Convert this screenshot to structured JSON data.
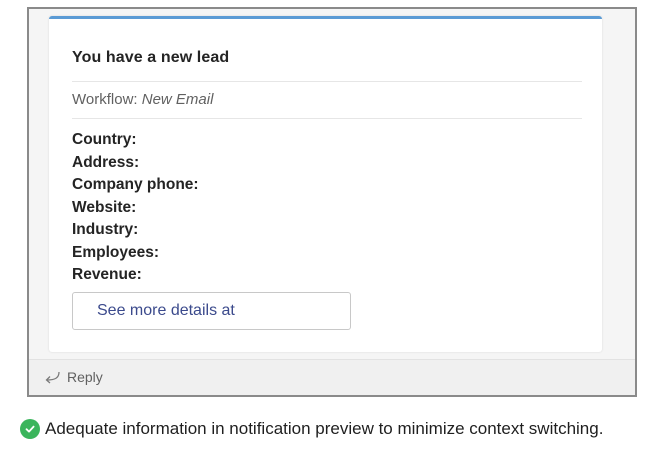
{
  "card": {
    "title": "You have a new lead",
    "workflow_label": "Workflow:",
    "workflow_value": "New Email",
    "fields": [
      "Country:",
      "Address:",
      "Company phone:",
      "Website:",
      "Industry:",
      "Employees:",
      "Revenue:"
    ],
    "details_button_label": "See more details at"
  },
  "reply": {
    "label": "Reply",
    "icon": "reply-arrow-icon"
  },
  "caption": {
    "icon": "check-circle-icon",
    "text": "Adequate information in notification preview to minimize context switching."
  },
  "colors": {
    "card_accent": "#5b9bd5",
    "button_text": "#3b4a8c",
    "check": "#3bb55c"
  }
}
